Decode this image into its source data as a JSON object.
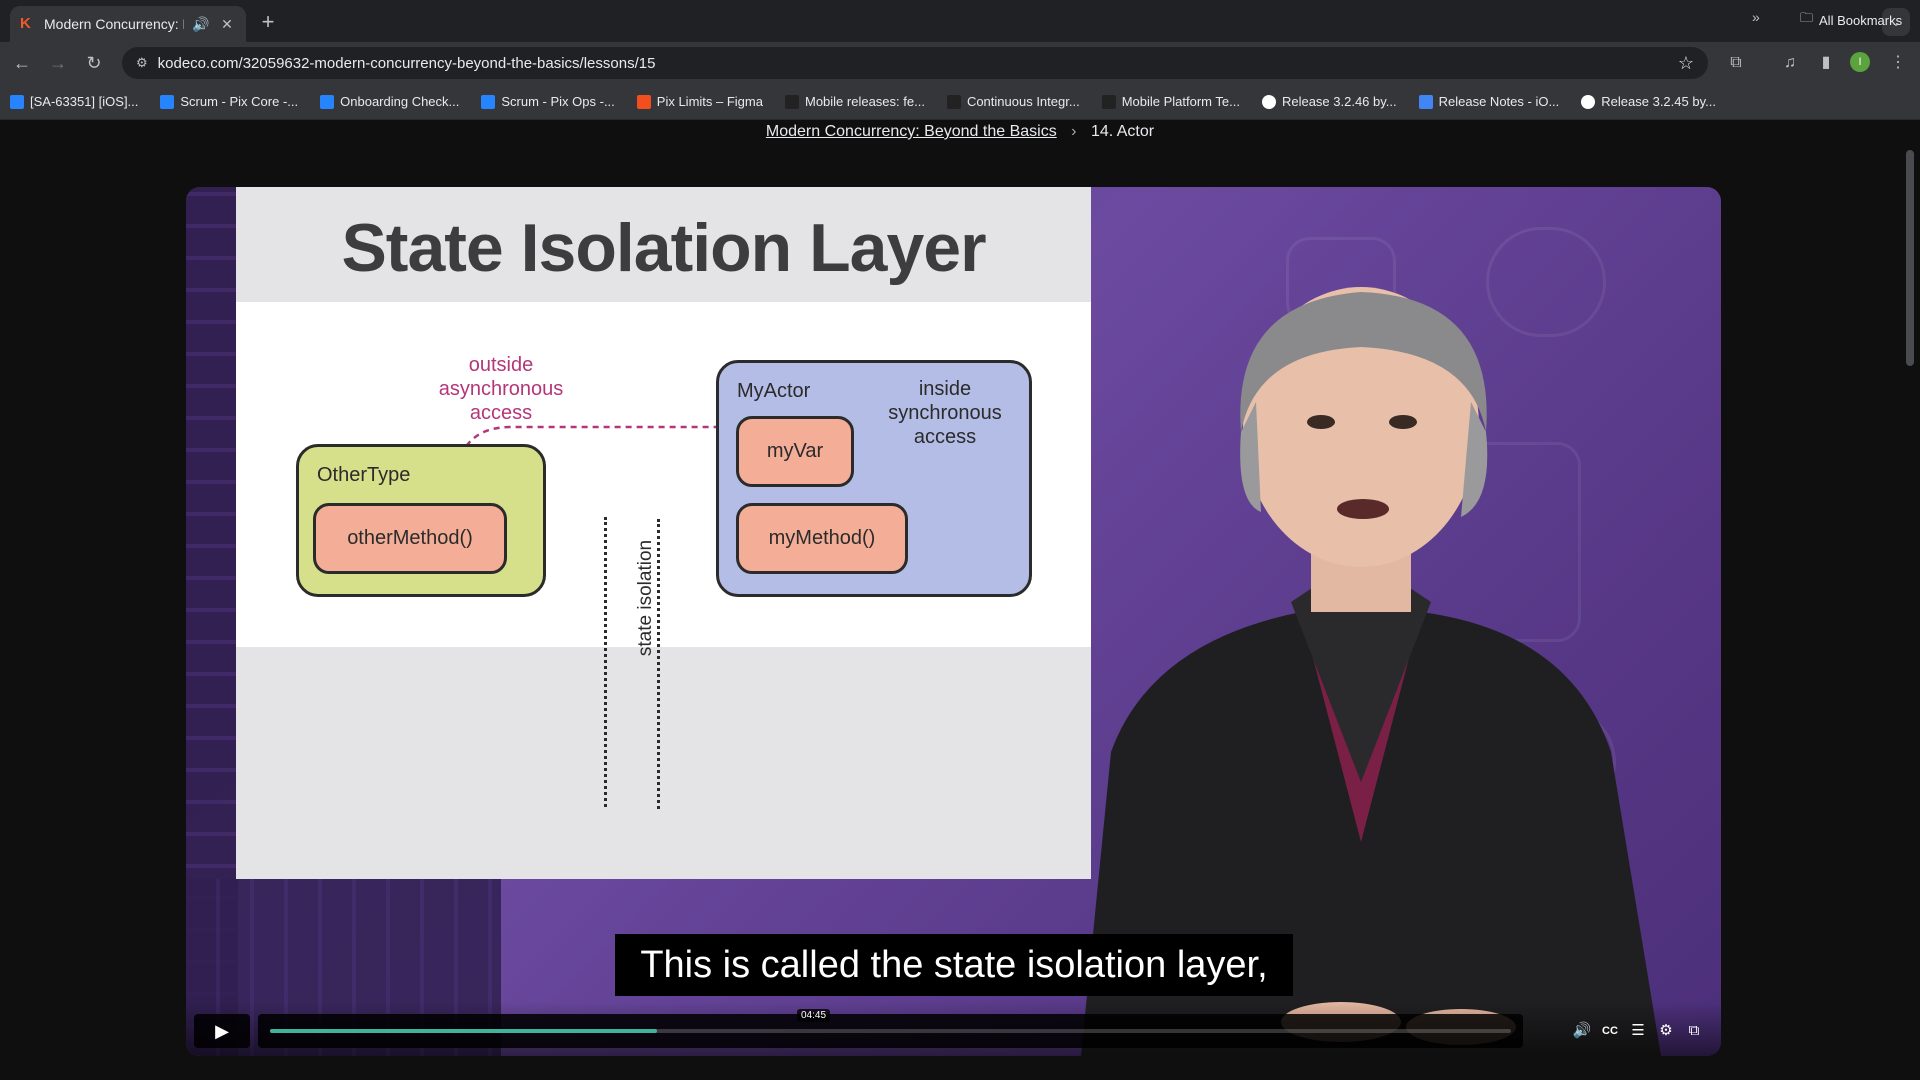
{
  "browser": {
    "tab": {
      "title": "Modern Concurrency: Beyond the Basics",
      "favicon": "K"
    },
    "url": "kodeco.com/32059632-modern-concurrency-beyond-the-basics/lessons/15",
    "profile_initial": "I",
    "bookmarks": [
      {
        "label": "[SA-63351] [iOS]...",
        "icon_color": "#2684ff",
        "icon": "jira-icon"
      },
      {
        "label": "Scrum - Pix Core -...",
        "icon_color": "#2684ff",
        "icon": "jira-icon"
      },
      {
        "label": "Onboarding Check...",
        "icon_color": "#2684ff",
        "icon": "confluence-icon"
      },
      {
        "label": "Scrum - Pix Ops -...",
        "icon_color": "#2684ff",
        "icon": "jira-icon"
      },
      {
        "label": "Pix Limits – Figma",
        "icon_color": "#f24e1e",
        "icon": "figma-icon"
      },
      {
        "label": "Mobile releases: fe...",
        "icon_color": "#222222",
        "icon": "rw-icon"
      },
      {
        "label": "Continuous Integr...",
        "icon_color": "#222222",
        "icon": "rw-icon"
      },
      {
        "label": "Mobile Platform Te...",
        "icon_color": "#222222",
        "icon": "rw-icon"
      },
      {
        "label": "Release 3.2.46 by...",
        "icon_color": "#ffffff",
        "icon": "github-icon"
      },
      {
        "label": "Release Notes - iO...",
        "icon_color": "#4285f4",
        "icon": "docs-icon"
      },
      {
        "label": "Release 3.2.45 by...",
        "icon_color": "#ffffff",
        "icon": "github-icon"
      }
    ],
    "all_bookmarks": "All Bookmarks"
  },
  "breadcrumb": {
    "course": "Modern Concurrency: Beyond the Basics",
    "lesson": "14. Actor"
  },
  "slide": {
    "title": "State Isolation Layer",
    "outside_label": [
      "outside",
      "asynchronous",
      "access"
    ],
    "inside_label": [
      "inside",
      "synchronous",
      "access"
    ],
    "other_type": "OtherType",
    "other_method": "otherMethod()",
    "my_actor": "MyActor",
    "my_var": "myVar",
    "my_method": "myMethod()",
    "isolation_label": "state isolation"
  },
  "video": {
    "caption": "This is called the state isolation layer,",
    "hover_time": "04:45",
    "progress": 0.312,
    "accent_color": "#3fb49a"
  }
}
